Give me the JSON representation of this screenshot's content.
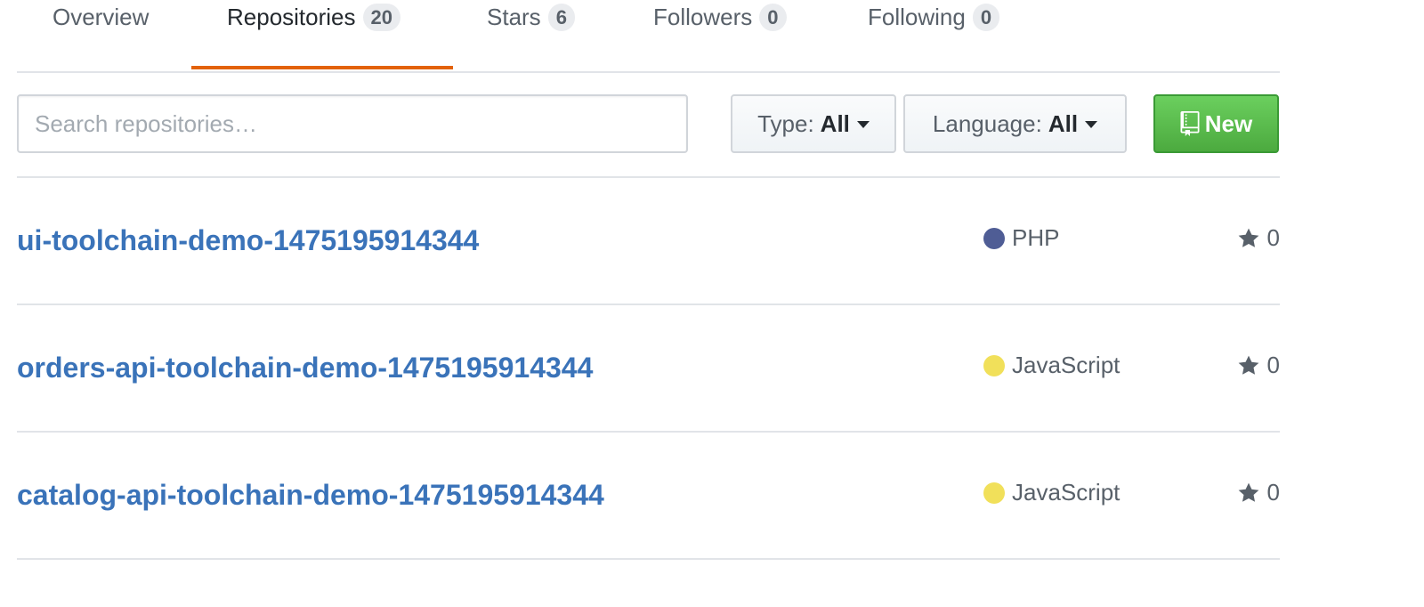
{
  "tabs": [
    {
      "label": "Overview",
      "count": null,
      "selected": false
    },
    {
      "label": "Repositories",
      "count": "20",
      "selected": true
    },
    {
      "label": "Stars",
      "count": "6",
      "selected": false
    },
    {
      "label": "Followers",
      "count": "0",
      "selected": false
    },
    {
      "label": "Following",
      "count": "0",
      "selected": false
    }
  ],
  "filter": {
    "search_placeholder": "Search repositories…",
    "type_label": "Type:",
    "type_value": "All",
    "language_label": "Language:",
    "language_value": "All",
    "new_label": "New"
  },
  "repos": [
    {
      "name": "ui-toolchain-demo-1475195914344",
      "language": "PHP",
      "language_color": "#4f5d95",
      "stars": "0"
    },
    {
      "name": "orders-api-toolchain-demo-1475195914344",
      "language": "JavaScript",
      "language_color": "#f1e05a",
      "stars": "0"
    },
    {
      "name": "catalog-api-toolchain-demo-1475195914344",
      "language": "JavaScript",
      "language_color": "#f1e05a",
      "stars": "0"
    }
  ],
  "colors": {
    "accent_tab": "#e36209",
    "link": "#3a73b9",
    "new_button": "#4caa3f"
  },
  "icons": {
    "new_button_icon": "repo-book-icon",
    "star_icon": "star-icon",
    "dropdown_icon": "caret-down-icon"
  }
}
